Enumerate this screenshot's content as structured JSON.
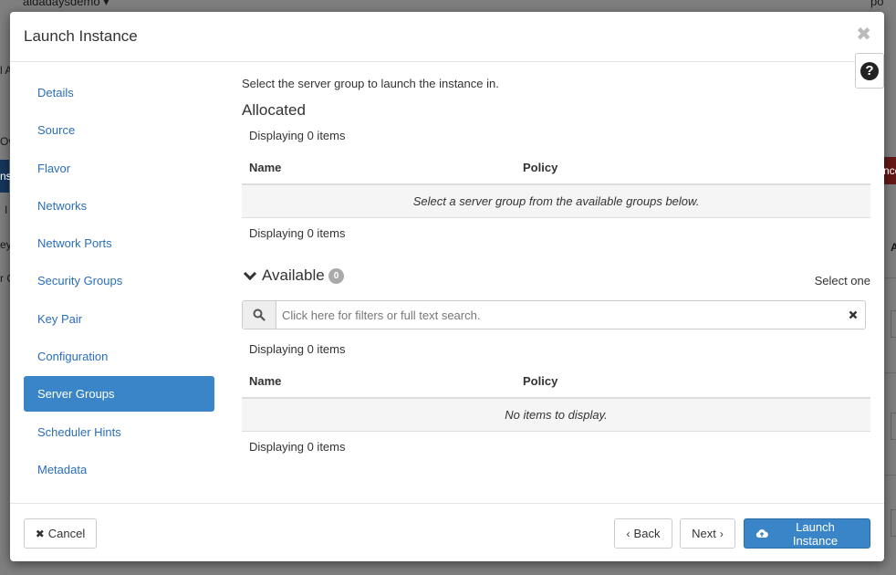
{
  "background": {
    "top_left": "aidadaysdemo ▾",
    "top_right": "po",
    "fragments": [
      "l A",
      "Ov",
      "ns",
      "I",
      "ey",
      "r C",
      "nce",
      "A"
    ]
  },
  "modal": {
    "title": "Launch Instance",
    "close_glyph": "✖",
    "help_glyph": "?"
  },
  "nav": {
    "items": [
      {
        "label": "Details"
      },
      {
        "label": "Source"
      },
      {
        "label": "Flavor"
      },
      {
        "label": "Networks"
      },
      {
        "label": "Network Ports"
      },
      {
        "label": "Security Groups"
      },
      {
        "label": "Key Pair"
      },
      {
        "label": "Configuration"
      },
      {
        "label": "Server Groups",
        "active": true
      },
      {
        "label": "Scheduler Hints"
      },
      {
        "label": "Metadata"
      }
    ]
  },
  "content": {
    "intro": "Select the server group to launch the instance in.",
    "allocated": {
      "heading": "Allocated",
      "displaying_top": "Displaying 0 items",
      "columns": [
        "Name",
        "Policy"
      ],
      "empty_message": "Select a server group from the available groups below.",
      "displaying_bottom": "Displaying 0 items"
    },
    "available": {
      "heading": "Available",
      "count": "0",
      "select_hint": "Select one",
      "search_placeholder": "Click here for filters or full text search.",
      "displaying_top": "Displaying 0 items",
      "columns": [
        "Name",
        "Policy"
      ],
      "empty_message": "No items to display.",
      "displaying_bottom": "Displaying 0 items"
    }
  },
  "footer": {
    "cancel": "Cancel",
    "back": "Back",
    "next": "Next",
    "launch": "Launch Instance"
  },
  "colors": {
    "primary": "#3a85c8",
    "link": "#2a6ebb"
  }
}
